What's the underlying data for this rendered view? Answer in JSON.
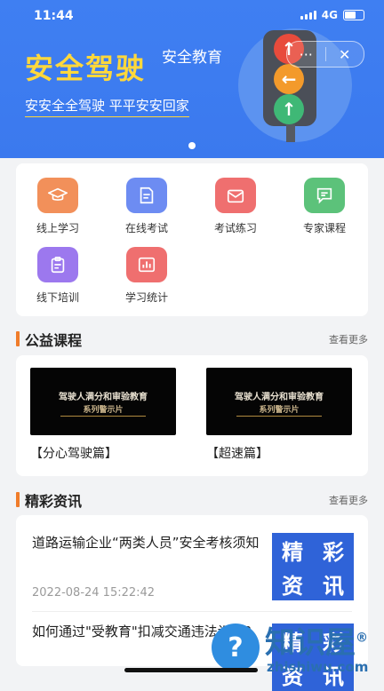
{
  "status": {
    "time": "11:44",
    "network": "4G"
  },
  "capsule": {
    "more": "···",
    "close": "✕"
  },
  "banner": {
    "title": "安全驾驶",
    "subtitle": "安全教育",
    "slogan": "安安全全驾驶  平平安安回家",
    "lamps": [
      "↑",
      "←",
      "↑"
    ]
  },
  "menu": [
    {
      "label": "线上学习",
      "icon": "graduation-cap-icon",
      "color": "#f2905a"
    },
    {
      "label": "在线考试",
      "icon": "document-icon",
      "color": "#6d8cf2"
    },
    {
      "label": "考试练习",
      "icon": "envelope-icon",
      "color": "#ef6f6f"
    },
    {
      "label": "专家课程",
      "icon": "chat-icon",
      "color": "#5cc27a"
    },
    {
      "label": "线下培训",
      "icon": "clipboard-icon",
      "color": "#9c78ee"
    },
    {
      "label": "学习统计",
      "icon": "chart-icon",
      "color": "#ef6f6f"
    }
  ],
  "courses_section": {
    "title": "公益课程",
    "more": "查看更多"
  },
  "courses": [
    {
      "thumb_title": "驾驶人满分和审验教育",
      "thumb_sub": "系列警示片",
      "label": "【分心驾驶篇】"
    },
    {
      "thumb_title": "驾驶人满分和审验教育",
      "thumb_sub": "系列警示片",
      "label": "【超速篇】"
    }
  ],
  "news_section": {
    "title": "精彩资讯",
    "more": "查看更多"
  },
  "news": [
    {
      "title": "道路运输企业“两类人员”安全考核须知",
      "date": "2022-08-24 15:22:42",
      "img_chars": [
        "精",
        "彩",
        "资",
        "讯"
      ]
    },
    {
      "title": "如何通过\"受教育\"扣减交通违法记分?",
      "date": "",
      "img_chars": [
        "精",
        "彩",
        "资",
        "讯"
      ]
    }
  ],
  "watermark": {
    "text": "知识屋",
    "domain": "zhishiwu.com",
    "mark": "®"
  }
}
